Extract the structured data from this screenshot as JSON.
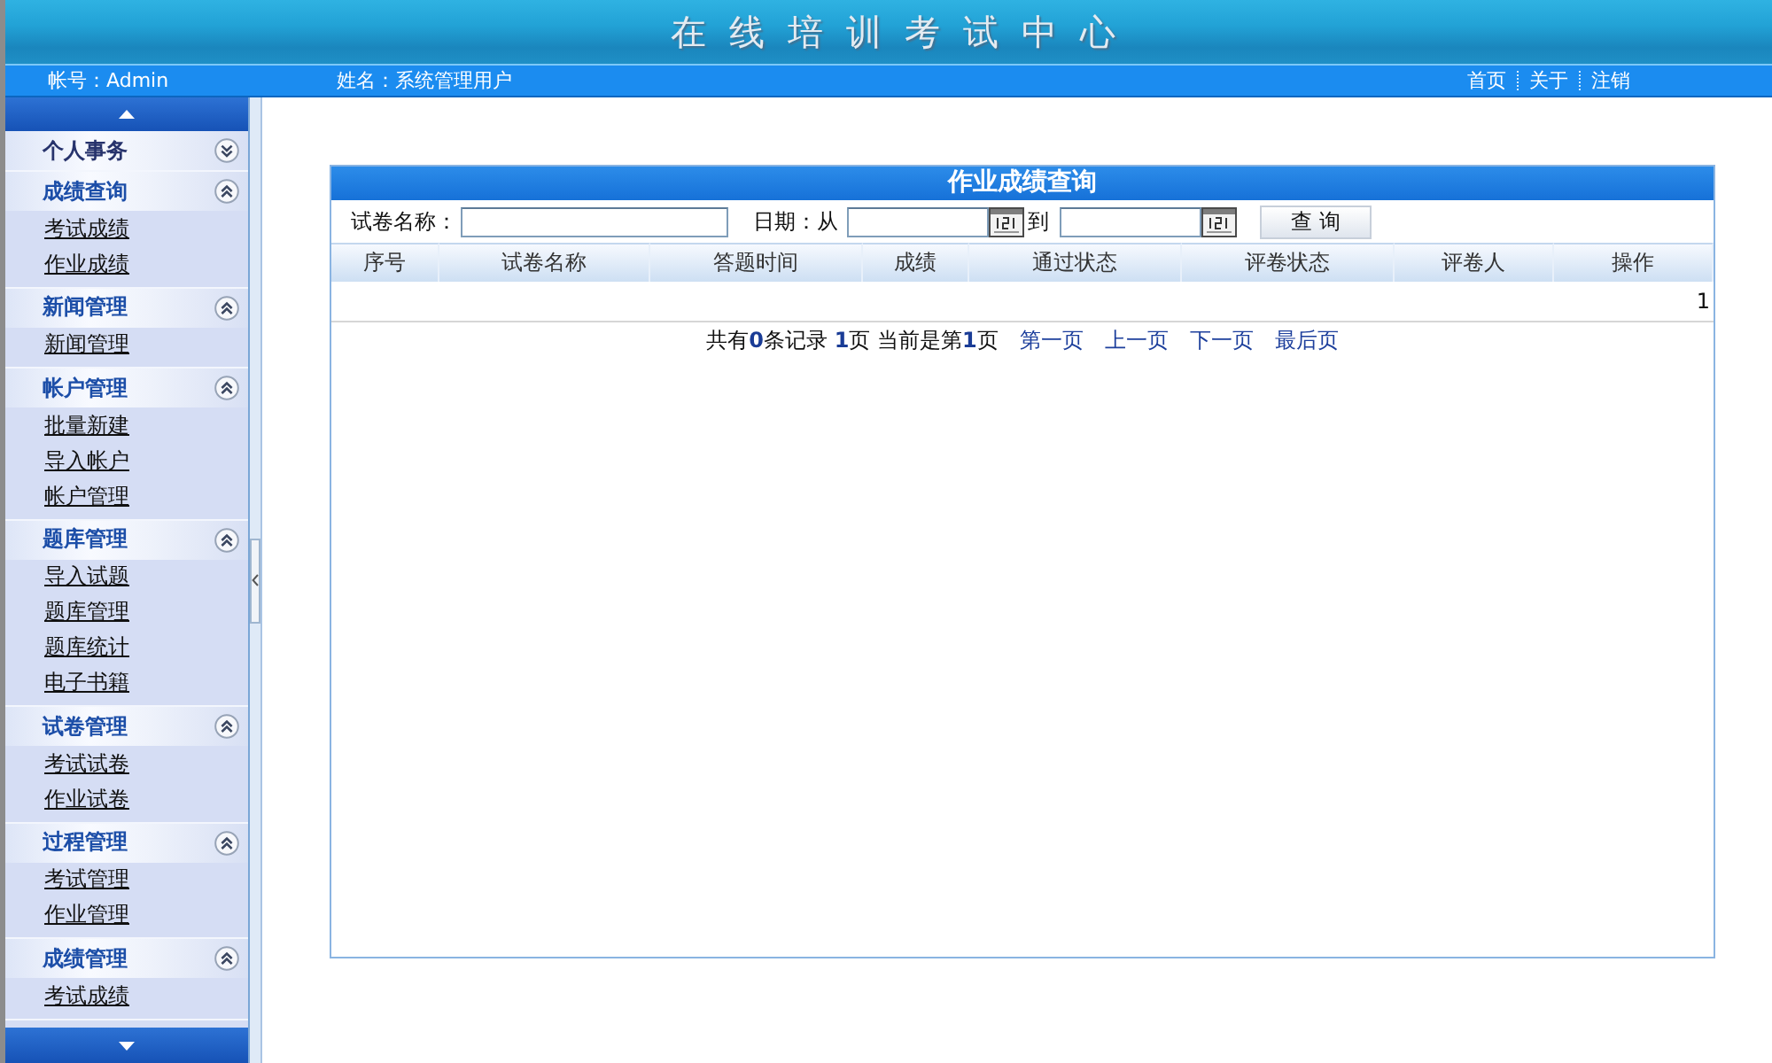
{
  "header": {
    "title": "在线培训考试中心"
  },
  "user_bar": {
    "account": "帐号：Admin",
    "user_name": "姓名：系统管理用户",
    "links": [
      "首页",
      "关于",
      "注销"
    ]
  },
  "sidebar": {
    "sections": [
      {
        "title": "个人事务",
        "expanded": false
      },
      {
        "title": "成绩查询",
        "expanded": true,
        "items": [
          "考试成绩",
          "作业成绩"
        ]
      },
      {
        "title": "新闻管理",
        "expanded": true,
        "items": [
          "新闻管理"
        ]
      },
      {
        "title": "帐户管理",
        "expanded": true,
        "items": [
          "批量新建",
          "导入帐户",
          "帐户管理"
        ]
      },
      {
        "title": "题库管理",
        "expanded": true,
        "items": [
          "导入试题",
          "题库管理",
          "题库统计",
          "电子书籍"
        ]
      },
      {
        "title": "试卷管理",
        "expanded": true,
        "items": [
          "考试试卷",
          "作业试卷"
        ]
      },
      {
        "title": "过程管理",
        "expanded": true,
        "items": [
          "考试管理",
          "作业管理"
        ]
      },
      {
        "title": "成绩管理",
        "expanded": true,
        "items": [
          "考试成绩"
        ]
      }
    ]
  },
  "panel": {
    "title": "作业成绩查询",
    "search": {
      "paper_name_label": "试卷名称：",
      "date_from_label": "日期：从",
      "date_to_label": "到",
      "button": "查 询"
    },
    "table": {
      "columns": [
        "序号",
        "试卷名称",
        "答题时间",
        "成绩",
        "通过状态",
        "评卷状态",
        "评卷人",
        "操作"
      ],
      "rows": [
        {
          "text": "1"
        }
      ]
    },
    "pagination": {
      "summary": "共有**0**条记录 **1**页 当前是第**1**页",
      "links": [
        "第一页",
        "上一页",
        "下一页",
        "最后页"
      ]
    }
  }
}
